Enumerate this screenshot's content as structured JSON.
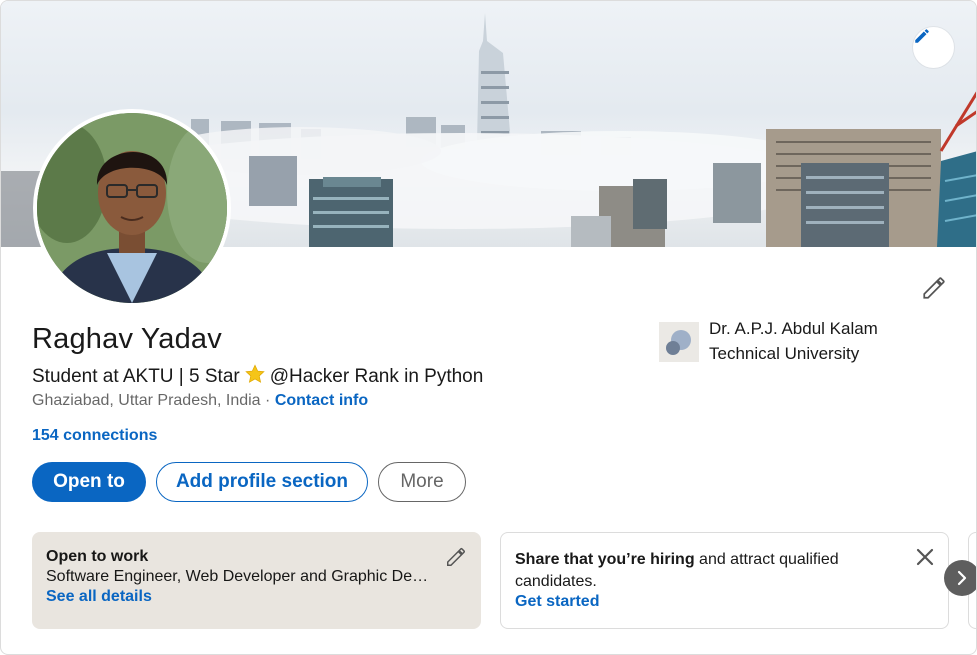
{
  "profile": {
    "name": "Raghav Yadav",
    "headline_before": "Student at AKTU | 5 Star",
    "headline_after": "@Hacker Rank in Python",
    "location": "Ghaziabad, Uttar Pradesh, India",
    "location_separator": "·",
    "contact_info": "Contact info",
    "connections": "154 connections"
  },
  "actions": {
    "open_to": "Open to",
    "add_section": "Add profile section",
    "more": "More"
  },
  "education": {
    "school_line1": "Dr. A.P.J. Abdul Kalam",
    "school_line2": "Technical University"
  },
  "open_to_work": {
    "title": "Open to work",
    "roles": "Software Engineer, Web Developer and Graphic Designer roles",
    "link": "See all details"
  },
  "hiring": {
    "text_bold": "Share that you’re hiring",
    "text_rest": " and attract qualified candidates.",
    "link": "Get started"
  },
  "icons": {
    "banner_edit": "pencil-icon",
    "intro_edit": "pencil-icon",
    "star": "star-icon",
    "close": "close-icon",
    "next": "chevron-right-icon"
  },
  "colors": {
    "primary": "#0a66c2",
    "open_to_work_bg": "#e9e5df"
  }
}
